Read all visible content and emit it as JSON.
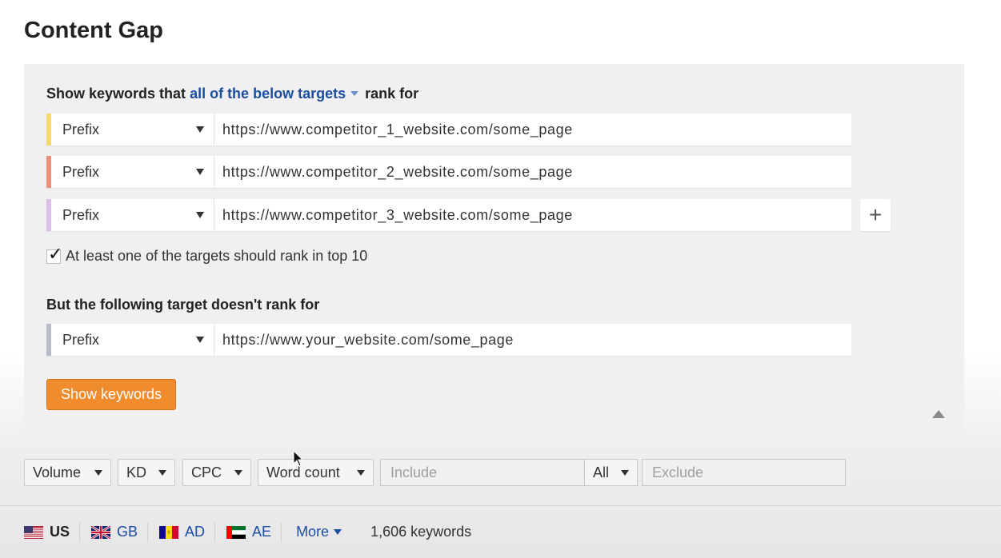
{
  "page": {
    "title": "Content Gap"
  },
  "panel": {
    "heading_prefix": "Show keywords that",
    "heading_link": "all of the below targets",
    "heading_suffix": "rank for",
    "targets": [
      {
        "mode": "Prefix",
        "url": "https://www.competitor_1_website.com/some_page",
        "color": "#f7d86a"
      },
      {
        "mode": "Prefix",
        "url": "https://www.competitor_2_website.com/some_page",
        "color": "#ee8f7c"
      },
      {
        "mode": "Prefix",
        "url": "https://www.competitor_3_website.com/some_page",
        "color": "#dcbfe6"
      }
    ],
    "add_label": "+",
    "top10_checked": true,
    "top10_label": "At least one of the targets should rank in top 10",
    "exclude_heading": "But the following target doesn't rank for",
    "exclude_target": {
      "mode": "Prefix",
      "url": "https://www.your_website.com/some_page",
      "color": "#b8bcc8"
    },
    "show_button": "Show keywords"
  },
  "filters": {
    "volume": "Volume",
    "kd": "KD",
    "cpc": "CPC",
    "word_count": "Word count",
    "include_placeholder": "Include",
    "all": "All",
    "exclude_placeholder": "Exclude"
  },
  "countries": [
    {
      "code": "US",
      "active": true
    },
    {
      "code": "GB",
      "active": false
    },
    {
      "code": "AD",
      "active": false
    },
    {
      "code": "AE",
      "active": false
    }
  ],
  "more_label": "More",
  "keyword_count": "1,606 keywords",
  "colors": {
    "accent": "#f08c2e",
    "link": "#1a4ea0"
  }
}
